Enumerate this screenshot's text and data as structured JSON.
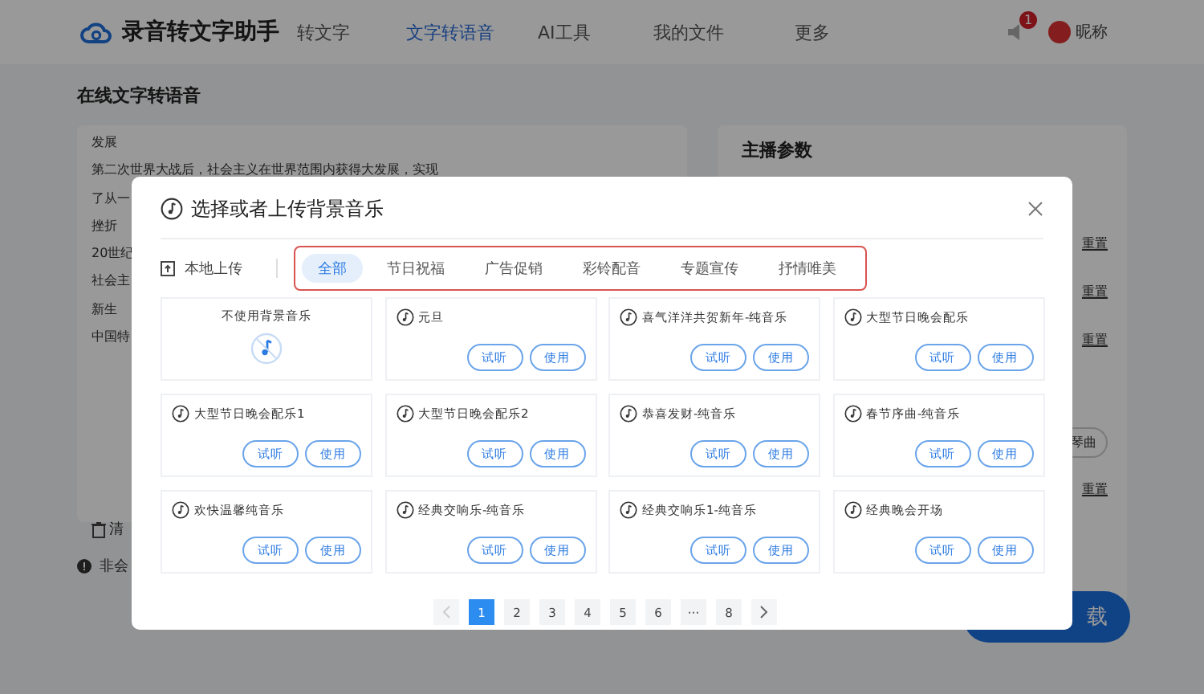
{
  "header": {
    "logo": "录音转文字助手",
    "nav": [
      {
        "label": "转文字",
        "selected": false
      },
      {
        "label": "文字转语音",
        "selected": true
      },
      {
        "label": "AI工具",
        "selected": false
      },
      {
        "label": "我的文件",
        "selected": false
      },
      {
        "label": "更多",
        "selected": false
      }
    ],
    "notification_badge": "1",
    "user": "昵称"
  },
  "page": {
    "title": "在线文字转语音",
    "text_lines": [
      "发展",
      "第二次世界大战后，社会主义在世界范围内获得大发展，实现",
      "了从一",
      "挫折",
      "20世纪",
      "社会主",
      "新生",
      "中国特"
    ],
    "side_panel": {
      "title": "主播参数",
      "items": [
        {
          "kind": "link",
          "label": "重置"
        },
        {
          "kind": "link",
          "label": "重置"
        },
        {
          "kind": "link",
          "label": "重置"
        },
        {
          "kind": "chip",
          "label": "琴曲"
        },
        {
          "kind": "link",
          "label": "重置"
        }
      ]
    },
    "clear_label": "清",
    "notice": "非会",
    "action_button": "载"
  },
  "dialog": {
    "title": "选择或者上传背景音乐",
    "upload": "本地上传",
    "tabs": [
      {
        "label": "全部",
        "selected": true
      },
      {
        "label": "节日祝福",
        "selected": false
      },
      {
        "label": "广告促销",
        "selected": false
      },
      {
        "label": "彩铃配音",
        "selected": false
      },
      {
        "label": "专题宣传",
        "selected": false
      },
      {
        "label": "抒情唯美",
        "selected": false
      }
    ],
    "items": [
      {
        "kind": "none",
        "name": "不使用背景音乐"
      },
      {
        "kind": "track",
        "name": "元旦",
        "preview": "试听",
        "use": "使用"
      },
      {
        "kind": "track",
        "name": "喜气洋洋共贺新年-纯音乐",
        "preview": "试听",
        "use": "使用"
      },
      {
        "kind": "track",
        "name": "大型节日晚会配乐",
        "preview": "试听",
        "use": "使用"
      },
      {
        "kind": "track",
        "name": "大型节日晚会配乐1",
        "preview": "试听",
        "use": "使用"
      },
      {
        "kind": "track",
        "name": "大型节日晚会配乐2",
        "preview": "试听",
        "use": "使用"
      },
      {
        "kind": "track",
        "name": "恭喜发财-纯音乐",
        "preview": "试听",
        "use": "使用"
      },
      {
        "kind": "track",
        "name": "春节序曲-纯音乐",
        "preview": "试听",
        "use": "使用"
      },
      {
        "kind": "track",
        "name": "欢快温馨纯音乐",
        "preview": "试听",
        "use": "使用"
      },
      {
        "kind": "track",
        "name": "经典交响乐-纯音乐",
        "preview": "试听",
        "use": "使用"
      },
      {
        "kind": "track",
        "name": "经典交响乐1-纯音乐",
        "preview": "试听",
        "use": "使用"
      },
      {
        "kind": "track",
        "name": "经典晚会开场",
        "preview": "试听",
        "use": "使用"
      }
    ],
    "pagination": {
      "prev_disabled": true,
      "pages": [
        {
          "label": "1",
          "selected": true
        },
        {
          "label": "2",
          "selected": false
        },
        {
          "label": "3",
          "selected": false
        },
        {
          "label": "4",
          "selected": false
        },
        {
          "label": "5",
          "selected": false
        },
        {
          "label": "6",
          "selected": false
        },
        {
          "label": "···",
          "selected": false
        },
        {
          "label": "8",
          "selected": false
        }
      ],
      "next_disabled": false
    }
  }
}
